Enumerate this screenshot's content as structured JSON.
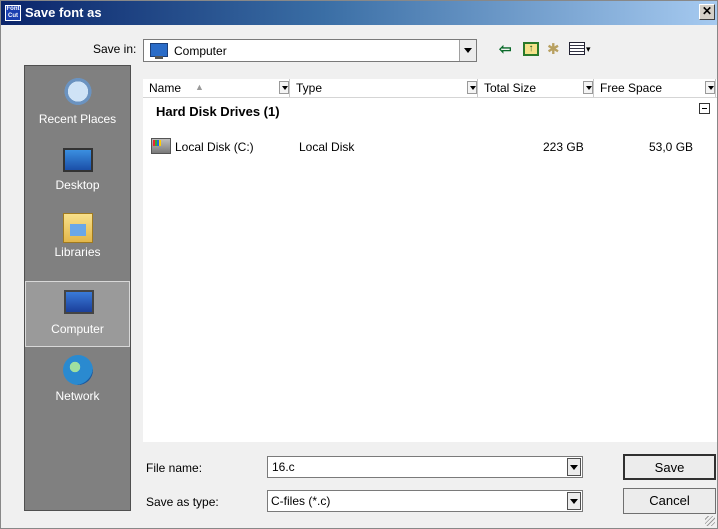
{
  "window": {
    "title": "Save font as",
    "app_icon_text": "Font Cut"
  },
  "toolbar": {
    "save_in_label": "Save in:",
    "save_in_value": "Computer"
  },
  "places": [
    {
      "label": "Recent Places",
      "icon": "recent-places-icon"
    },
    {
      "label": "Desktop",
      "icon": "desktop-icon"
    },
    {
      "label": "Libraries",
      "icon": "libraries-icon"
    },
    {
      "label": "Computer",
      "icon": "computer-icon",
      "selected": true
    },
    {
      "label": "Network",
      "icon": "network-icon"
    }
  ],
  "columns": [
    "Name",
    "Type",
    "Total Size",
    "Free Space"
  ],
  "group": {
    "title": "Hard Disk Drives (1)"
  },
  "rows": [
    {
      "name": "Local Disk (C:)",
      "type": "Local Disk",
      "total": "223 GB",
      "free": "53,0 GB"
    }
  ],
  "file_name": {
    "label": "File name:",
    "value": "16.c"
  },
  "file_type": {
    "label": "Save as type:",
    "value": "C-files (*.c)"
  },
  "buttons": {
    "save": "Save",
    "cancel": "Cancel"
  }
}
